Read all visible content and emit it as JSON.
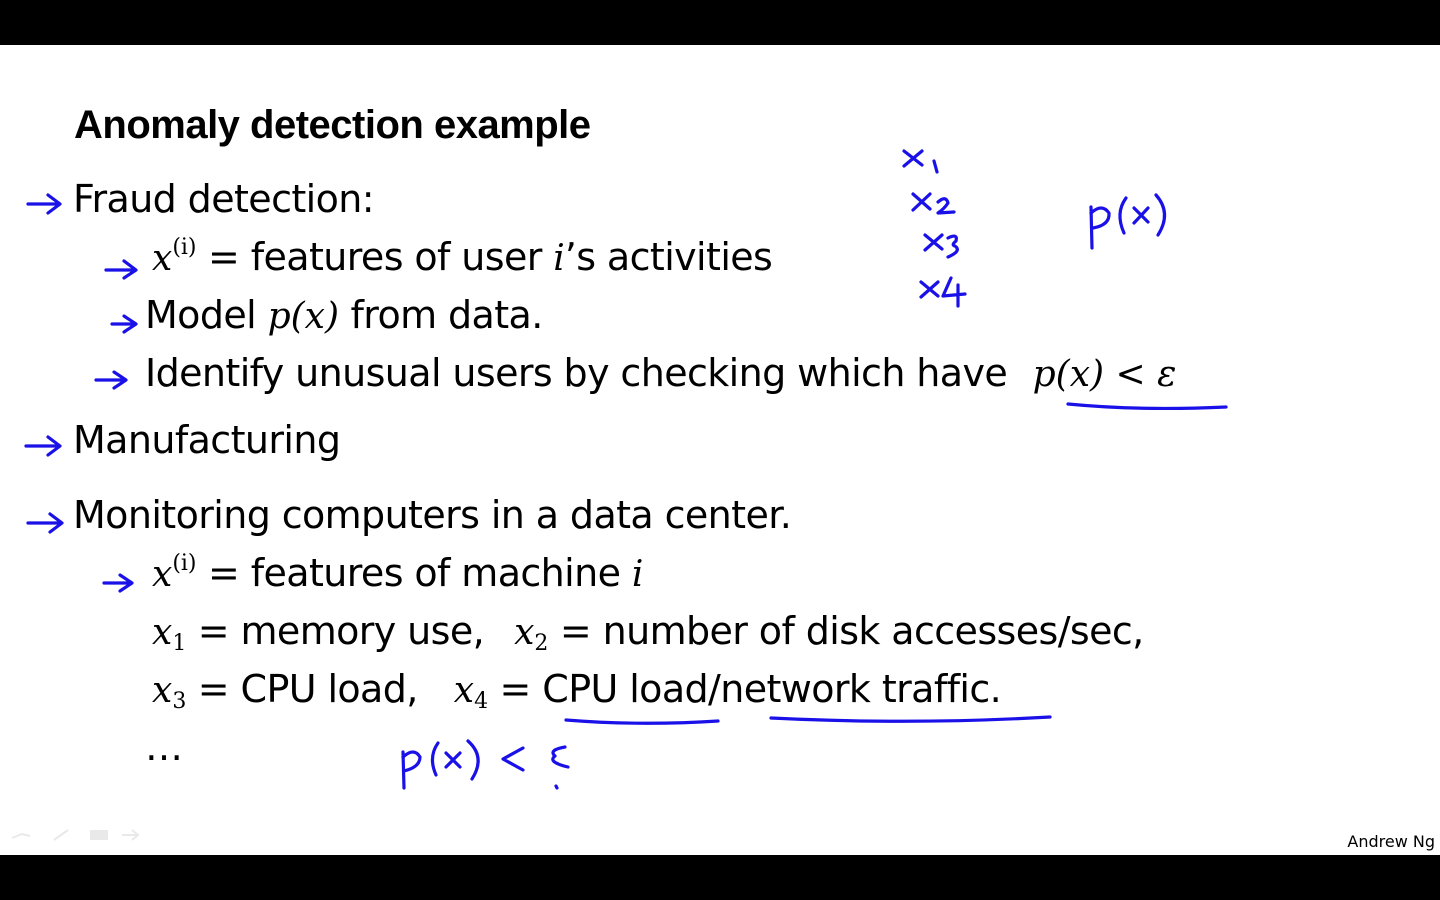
{
  "slide": {
    "title": "Anomaly detection example",
    "fraud": {
      "heading": "Fraud detection:",
      "item1_var": "x",
      "item1_sup": "(i)",
      "item1_text_a": " = features of user ",
      "item1_i": "i",
      "item1_text_b": "’s activities",
      "item2_text_a": "Model ",
      "item2_math": "p(x)",
      "item2_text_b": " from data.",
      "item3_text": "Identify unusual users by checking which have ",
      "item3_math": "p(x) < ε"
    },
    "manufacturing": {
      "heading": "Manufacturing"
    },
    "monitoring": {
      "heading": "Monitoring computers in a data center.",
      "item1_var": "x",
      "item1_sup": "(i)",
      "item1_text": " = features of machine ",
      "item1_i": "i",
      "x1_var": "x",
      "x1_sub": "1",
      "x1_text": " = memory use,",
      "x2_var": "x",
      "x2_sub": "2",
      "x2_text": " = number of disk accesses/sec,",
      "x3_var": "x",
      "x3_sub": "3",
      "x3_text": " = CPU load,",
      "x4_var": "x",
      "x4_sub": "4",
      "x4_text_a": " = ",
      "x4_text_b": "CPU load/network traffic.",
      "ellipsis": "…"
    },
    "credit": "Andrew Ng"
  },
  "handwriting": {
    "features": [
      "x₁",
      "x₂",
      "x₃",
      "x₄"
    ],
    "model": "p(x)",
    "threshold": "p(x) < ε"
  },
  "colors": {
    "ink": "#1a10e8",
    "text": "#000000",
    "background": "#ffffff",
    "letterbox": "#000000"
  }
}
